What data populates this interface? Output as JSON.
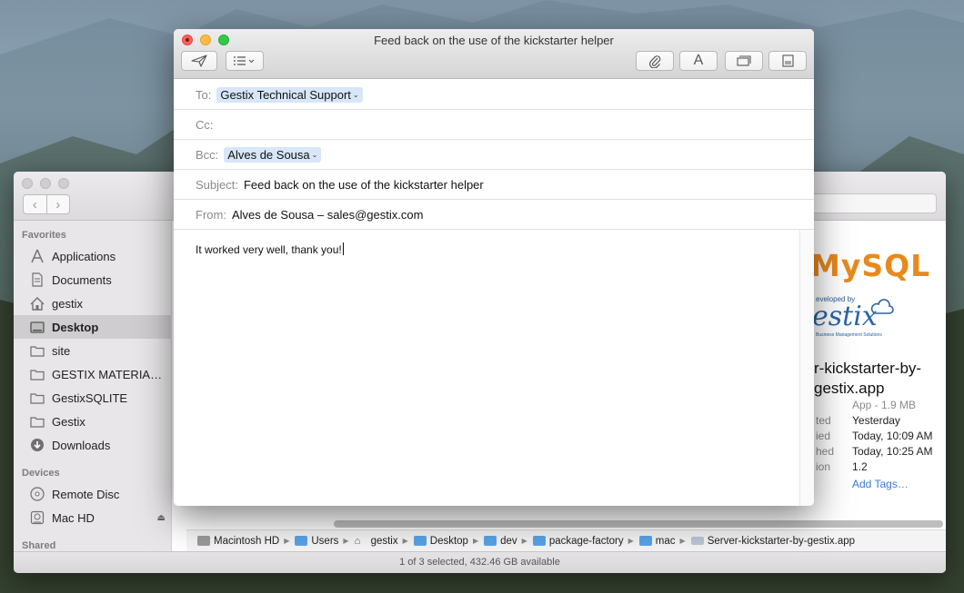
{
  "mail": {
    "title": "Feed back on the use of the kickstarter helper",
    "to_label": "To:",
    "to_value": "Gestix Technical Support",
    "cc_label": "Cc:",
    "bcc_label": "Bcc:",
    "bcc_value": "Alves de Sousa",
    "subject_label": "Subject:",
    "subject_value": "Feed back on the use of the kickstarter helper",
    "from_label": "From:",
    "from_value": "Alves de Sousa – sales@gestix.com",
    "body": "It worked very well, thank you!",
    "icons": {
      "send": "paper-plane-icon",
      "header_fields": "list-icon",
      "attach": "paperclip-icon",
      "format": "font-icon",
      "photo": "photo-browser-icon",
      "stationery": "stationery-icon"
    },
    "format_glyph": "A"
  },
  "finder": {
    "sidebar": {
      "favorites_label": "Favorites",
      "favorites": [
        {
          "label": "Applications",
          "icon": "applications-icon"
        },
        {
          "label": "Documents",
          "icon": "documents-icon"
        },
        {
          "label": "gestix",
          "icon": "home-icon"
        },
        {
          "label": "Desktop",
          "icon": "desktop-icon"
        },
        {
          "label": "site",
          "icon": "folder-icon"
        },
        {
          "label": "GESTIX MATERIA…",
          "icon": "folder-icon"
        },
        {
          "label": "GestixSQLITE",
          "icon": "folder-icon"
        },
        {
          "label": "Gestix",
          "icon": "folder-icon"
        },
        {
          "label": "Downloads",
          "icon": "downloads-icon"
        }
      ],
      "devices_label": "Devices",
      "devices": [
        {
          "label": "Remote Disc",
          "icon": "disc-icon"
        },
        {
          "label": "Mac HD",
          "icon": "hard-drive-icon"
        }
      ],
      "shared_label": "Shared"
    },
    "preview": {
      "logo_text": "MySQL",
      "developed_by": "eveloped by",
      "gestix_logo": "estix",
      "gestix_sub": "Business Management Solutions",
      "app_name": "r-kickstarter-by-gestix.app",
      "app_kind": "App - 1.9 MB",
      "meta": [
        {
          "key": "ted",
          "value": "Yesterday"
        },
        {
          "key": "ied",
          "value": "Today, 10:09 AM"
        },
        {
          "key": "hed",
          "value": "Today, 10:25 AM"
        },
        {
          "key": "ion",
          "value": "1.2"
        }
      ],
      "add_tags": "Add Tags…"
    },
    "path": [
      "Macintosh HD",
      "Users",
      "gestix",
      "Desktop",
      "dev",
      "package-factory",
      "mac",
      "Server-kickstarter-by-gestix.app"
    ],
    "status": "1 of 3 selected, 432.46 GB available"
  }
}
